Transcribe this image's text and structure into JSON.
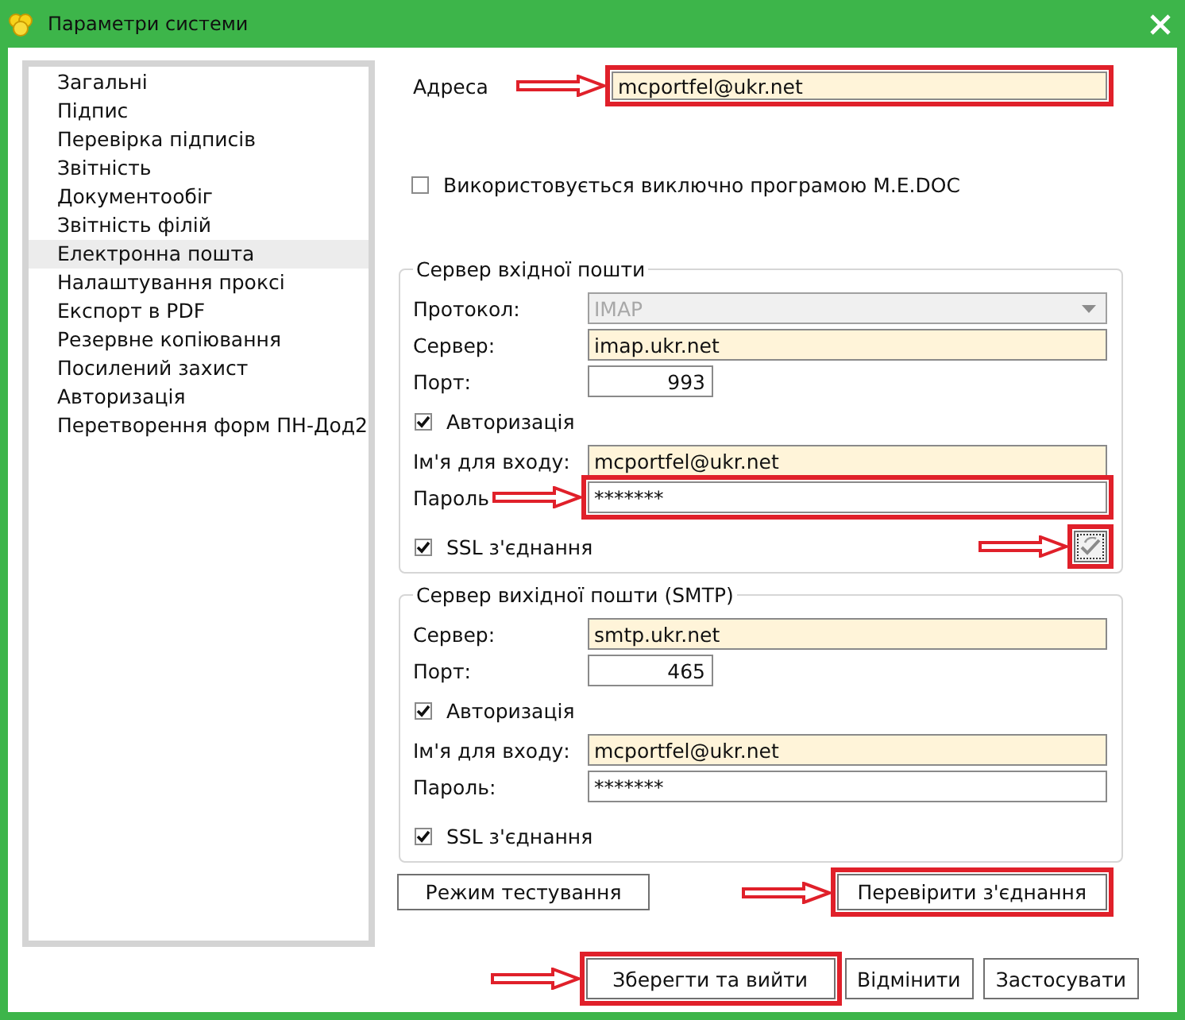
{
  "window": {
    "title": "Параметри системи"
  },
  "sidebar": {
    "items": [
      {
        "label": "Загальні",
        "selected": false
      },
      {
        "label": "Підпис",
        "selected": false
      },
      {
        "label": "Перевірка підписів",
        "selected": false
      },
      {
        "label": "Звітність",
        "selected": false
      },
      {
        "label": "Документообіг",
        "selected": false
      },
      {
        "label": "Звітність філій",
        "selected": false
      },
      {
        "label": "Електронна пошта",
        "selected": true
      },
      {
        "label": "Налаштування проксі",
        "selected": false
      },
      {
        "label": "Експорт в PDF",
        "selected": false
      },
      {
        "label": "Резервне копіювання",
        "selected": false
      },
      {
        "label": "Посилений захист",
        "selected": false
      },
      {
        "label": "Авторизація",
        "selected": false
      },
      {
        "label": "Перетворення форм ПН-Дод2",
        "selected": false
      }
    ]
  },
  "address": {
    "label": "Адреса",
    "value": "mcportfel@ukr.net",
    "annotated": true
  },
  "exclusive_option": {
    "label": "Використовується виключно програмою M.E.DOC",
    "checked": false
  },
  "groups": [
    {
      "title": "Сервер вхідної пошти",
      "rows": [
        {
          "kind": "select",
          "label": "Протокол:",
          "value": "IMAP",
          "disabled": true,
          "annotated": false
        },
        {
          "kind": "text",
          "label": "Сервер:",
          "value": "imap.ukr.net",
          "disabled": false,
          "annotated": false
        },
        {
          "kind": "number",
          "label": "Порт:",
          "value": "993",
          "disabled": false,
          "annotated": false
        },
        {
          "kind": "checkbox",
          "label": "Авторизація",
          "checked": true,
          "disabled": false,
          "annotated": false
        },
        {
          "kind": "text",
          "label": "Ім'я для входу:",
          "value": "mcportfel@ukr.net",
          "disabled": false,
          "annotated": false
        },
        {
          "kind": "password",
          "label": "Пароль",
          "value": "*******",
          "disabled": false,
          "annotated": true
        },
        {
          "kind": "checkbox",
          "label": "SSL з'єднання",
          "checked": true,
          "disabled": false,
          "annotated": false,
          "icon_button": {
            "annotated": true
          }
        }
      ]
    },
    {
      "title": "Сервер вихідної пошти (SMTP)",
      "rows": [
        {
          "kind": "text",
          "label": "Сервер:",
          "value": "smtp.ukr.net",
          "disabled": false,
          "annotated": false
        },
        {
          "kind": "number",
          "label": "Порт:",
          "value": "465",
          "disabled": false,
          "annotated": false
        },
        {
          "kind": "checkbox",
          "label": "Авторизація",
          "checked": true,
          "disabled": false,
          "annotated": false
        },
        {
          "kind": "text",
          "label": "Ім'я для входу:",
          "value": "mcportfel@ukr.net",
          "disabled": false,
          "annotated": false
        },
        {
          "kind": "password",
          "label": "Пароль:",
          "value": "*******",
          "disabled": false,
          "annotated": false
        },
        {
          "kind": "checkbox",
          "label": "SSL з'єднання",
          "checked": true,
          "disabled": false,
          "annotated": false
        }
      ]
    }
  ],
  "test_buttons": [
    {
      "label": "Режим тестування",
      "annotated": false
    },
    {
      "label": "Перевірити з'єднання",
      "annotated": true
    }
  ],
  "footer_buttons": [
    {
      "label": "Зберегти та вийти",
      "annotated": true
    },
    {
      "label": "Відмінити",
      "annotated": false
    },
    {
      "label": "Застосувати",
      "annotated": false
    }
  ]
}
